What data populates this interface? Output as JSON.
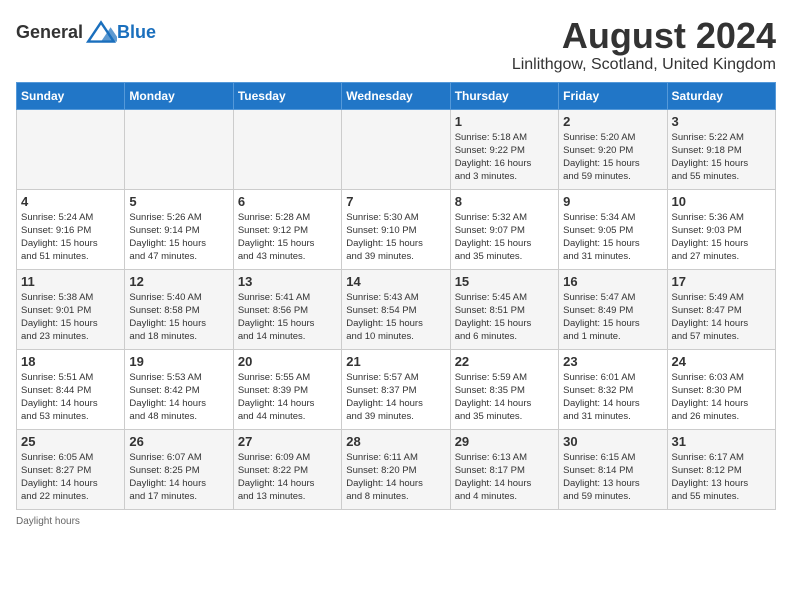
{
  "header": {
    "logo_general": "General",
    "logo_blue": "Blue",
    "month_title": "August 2024",
    "location": "Linlithgow, Scotland, United Kingdom"
  },
  "columns": [
    "Sunday",
    "Monday",
    "Tuesday",
    "Wednesday",
    "Thursday",
    "Friday",
    "Saturday"
  ],
  "footer": {
    "daylight_label": "Daylight hours"
  },
  "weeks": [
    [
      {
        "day": "",
        "info": ""
      },
      {
        "day": "",
        "info": ""
      },
      {
        "day": "",
        "info": ""
      },
      {
        "day": "",
        "info": ""
      },
      {
        "day": "1",
        "info": "Sunrise: 5:18 AM\nSunset: 9:22 PM\nDaylight: 16 hours\nand 3 minutes."
      },
      {
        "day": "2",
        "info": "Sunrise: 5:20 AM\nSunset: 9:20 PM\nDaylight: 15 hours\nand 59 minutes."
      },
      {
        "day": "3",
        "info": "Sunrise: 5:22 AM\nSunset: 9:18 PM\nDaylight: 15 hours\nand 55 minutes."
      }
    ],
    [
      {
        "day": "4",
        "info": "Sunrise: 5:24 AM\nSunset: 9:16 PM\nDaylight: 15 hours\nand 51 minutes."
      },
      {
        "day": "5",
        "info": "Sunrise: 5:26 AM\nSunset: 9:14 PM\nDaylight: 15 hours\nand 47 minutes."
      },
      {
        "day": "6",
        "info": "Sunrise: 5:28 AM\nSunset: 9:12 PM\nDaylight: 15 hours\nand 43 minutes."
      },
      {
        "day": "7",
        "info": "Sunrise: 5:30 AM\nSunset: 9:10 PM\nDaylight: 15 hours\nand 39 minutes."
      },
      {
        "day": "8",
        "info": "Sunrise: 5:32 AM\nSunset: 9:07 PM\nDaylight: 15 hours\nand 35 minutes."
      },
      {
        "day": "9",
        "info": "Sunrise: 5:34 AM\nSunset: 9:05 PM\nDaylight: 15 hours\nand 31 minutes."
      },
      {
        "day": "10",
        "info": "Sunrise: 5:36 AM\nSunset: 9:03 PM\nDaylight: 15 hours\nand 27 minutes."
      }
    ],
    [
      {
        "day": "11",
        "info": "Sunrise: 5:38 AM\nSunset: 9:01 PM\nDaylight: 15 hours\nand 23 minutes."
      },
      {
        "day": "12",
        "info": "Sunrise: 5:40 AM\nSunset: 8:58 PM\nDaylight: 15 hours\nand 18 minutes."
      },
      {
        "day": "13",
        "info": "Sunrise: 5:41 AM\nSunset: 8:56 PM\nDaylight: 15 hours\nand 14 minutes."
      },
      {
        "day": "14",
        "info": "Sunrise: 5:43 AM\nSunset: 8:54 PM\nDaylight: 15 hours\nand 10 minutes."
      },
      {
        "day": "15",
        "info": "Sunrise: 5:45 AM\nSunset: 8:51 PM\nDaylight: 15 hours\nand 6 minutes."
      },
      {
        "day": "16",
        "info": "Sunrise: 5:47 AM\nSunset: 8:49 PM\nDaylight: 15 hours\nand 1 minute."
      },
      {
        "day": "17",
        "info": "Sunrise: 5:49 AM\nSunset: 8:47 PM\nDaylight: 14 hours\nand 57 minutes."
      }
    ],
    [
      {
        "day": "18",
        "info": "Sunrise: 5:51 AM\nSunset: 8:44 PM\nDaylight: 14 hours\nand 53 minutes."
      },
      {
        "day": "19",
        "info": "Sunrise: 5:53 AM\nSunset: 8:42 PM\nDaylight: 14 hours\nand 48 minutes."
      },
      {
        "day": "20",
        "info": "Sunrise: 5:55 AM\nSunset: 8:39 PM\nDaylight: 14 hours\nand 44 minutes."
      },
      {
        "day": "21",
        "info": "Sunrise: 5:57 AM\nSunset: 8:37 PM\nDaylight: 14 hours\nand 39 minutes."
      },
      {
        "day": "22",
        "info": "Sunrise: 5:59 AM\nSunset: 8:35 PM\nDaylight: 14 hours\nand 35 minutes."
      },
      {
        "day": "23",
        "info": "Sunrise: 6:01 AM\nSunset: 8:32 PM\nDaylight: 14 hours\nand 31 minutes."
      },
      {
        "day": "24",
        "info": "Sunrise: 6:03 AM\nSunset: 8:30 PM\nDaylight: 14 hours\nand 26 minutes."
      }
    ],
    [
      {
        "day": "25",
        "info": "Sunrise: 6:05 AM\nSunset: 8:27 PM\nDaylight: 14 hours\nand 22 minutes."
      },
      {
        "day": "26",
        "info": "Sunrise: 6:07 AM\nSunset: 8:25 PM\nDaylight: 14 hours\nand 17 minutes."
      },
      {
        "day": "27",
        "info": "Sunrise: 6:09 AM\nSunset: 8:22 PM\nDaylight: 14 hours\nand 13 minutes."
      },
      {
        "day": "28",
        "info": "Sunrise: 6:11 AM\nSunset: 8:20 PM\nDaylight: 14 hours\nand 8 minutes."
      },
      {
        "day": "29",
        "info": "Sunrise: 6:13 AM\nSunset: 8:17 PM\nDaylight: 14 hours\nand 4 minutes."
      },
      {
        "day": "30",
        "info": "Sunrise: 6:15 AM\nSunset: 8:14 PM\nDaylight: 13 hours\nand 59 minutes."
      },
      {
        "day": "31",
        "info": "Sunrise: 6:17 AM\nSunset: 8:12 PM\nDaylight: 13 hours\nand 55 minutes."
      }
    ]
  ]
}
